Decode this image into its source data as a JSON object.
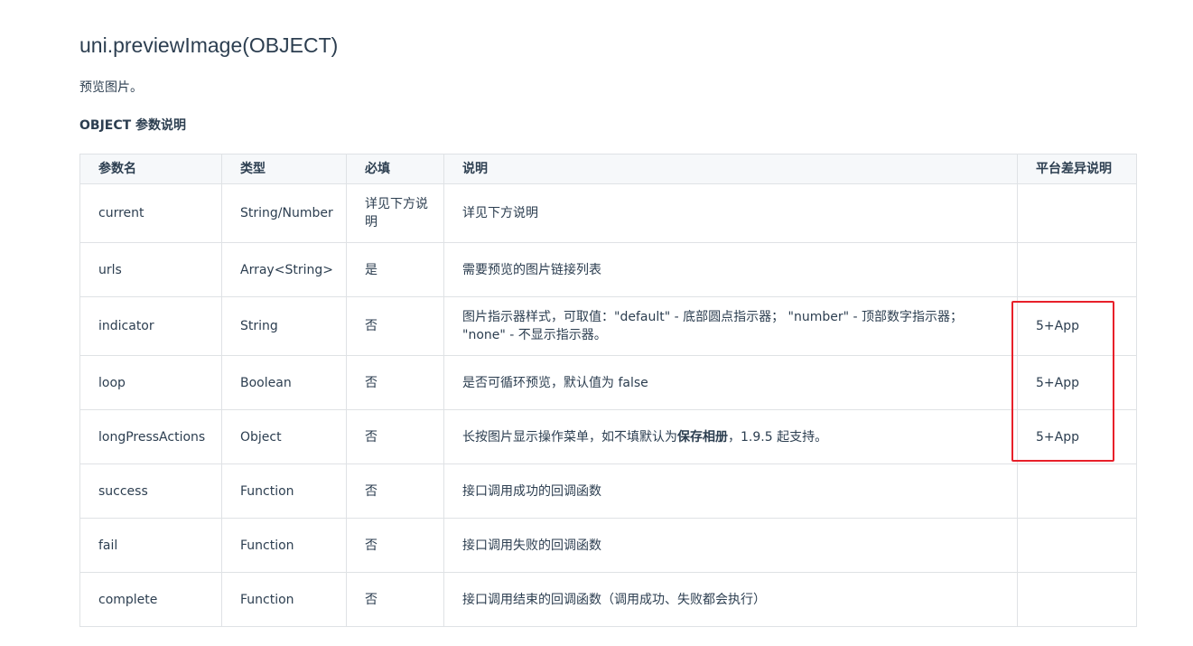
{
  "api_title": "uni.previewImage(OBJECT)",
  "description": "预览图片。",
  "section_title": "OBJECT 参数说明",
  "table": {
    "headers": {
      "name": "参数名",
      "type": "类型",
      "required": "必填",
      "desc": "说明",
      "platform": "平台差异说明"
    },
    "rows": [
      {
        "name": "current",
        "type": "String/Number",
        "required": "详见下方说明",
        "desc": "详见下方说明",
        "platform": ""
      },
      {
        "name": "urls",
        "type": "Array<String>",
        "required": "是",
        "desc": "需要预览的图片链接列表",
        "platform": ""
      },
      {
        "name": "indicator",
        "type": "String",
        "required": "否",
        "desc": "图片指示器样式，可取值：\"default\" - 底部圆点指示器； \"number\" - 顶部数字指示器； \"none\" - 不显示指示器。",
        "platform": "5+App"
      },
      {
        "name": "loop",
        "type": "Boolean",
        "required": "否",
        "desc": "是否可循环预览，默认值为 false",
        "platform": "5+App"
      },
      {
        "name": "longPressActions",
        "type": "Object",
        "required": "否",
        "desc_before": "长按图片显示操作菜单，如不填默认为",
        "desc_bold": "保存相册",
        "desc_after": "，1.9.5 起支持。",
        "platform": "5+App"
      },
      {
        "name": "success",
        "type": "Function",
        "required": "否",
        "desc": "接口调用成功的回调函数",
        "platform": ""
      },
      {
        "name": "fail",
        "type": "Function",
        "required": "否",
        "desc": "接口调用失败的回调函数",
        "platform": ""
      },
      {
        "name": "complete",
        "type": "Function",
        "required": "否",
        "desc": "接口调用结束的回调函数（调用成功、失败都会执行）",
        "platform": ""
      }
    ]
  },
  "highlight_color": "#e8202a"
}
